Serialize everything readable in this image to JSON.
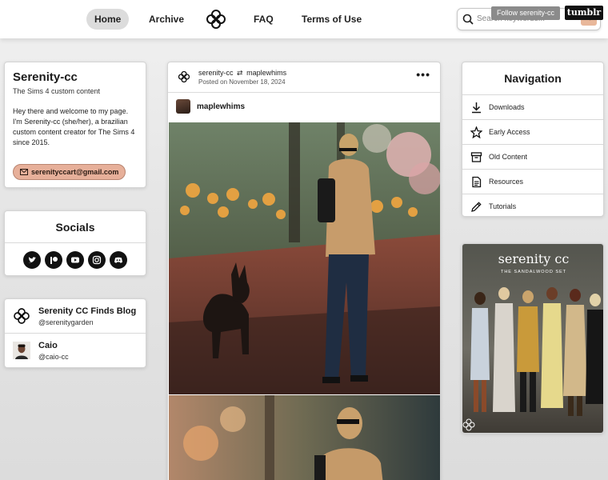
{
  "topnav": {
    "home": "Home",
    "archive": "Archive",
    "faq": "FAQ",
    "terms": "Terms of Use",
    "search_placeholder": "Search keywords...",
    "follow_label": "Follow serenity-cc",
    "tumblr_label": "tumblr"
  },
  "profile": {
    "name": "Serenity-cc",
    "tagline": "The Sims 4 custom content",
    "bio": "Hey there and welcome to my page. I'm Serenity-cc (she/her), a brazilian custom content creator for The Sims 4 since 2015.",
    "email": "serenityccart@gmail.com"
  },
  "socials": {
    "heading": "Socials",
    "icons": [
      "twitter-icon",
      "patreon-icon",
      "youtube-icon",
      "instagram-icon",
      "discord-icon"
    ]
  },
  "blogs": [
    {
      "title": "Serenity CC Finds Blog",
      "handle": "@serenitygarden"
    },
    {
      "title": "Caio",
      "handle": "@caio-cc"
    }
  ],
  "post": {
    "author": "serenity-cc",
    "reblog_from": "maplewhims",
    "date": "Posted on November 18, 2024",
    "more": "•••",
    "source_name": "maplewhims"
  },
  "navigation": {
    "heading": "Navigation",
    "items": [
      {
        "label": "Downloads",
        "icon": "download-icon"
      },
      {
        "label": "Early Access",
        "icon": "star-icon"
      },
      {
        "label": "Old Content",
        "icon": "archive-box-icon"
      },
      {
        "label": "Resources",
        "icon": "document-icon"
      },
      {
        "label": "Tutorials",
        "icon": "pencil-icon"
      }
    ]
  },
  "promo": {
    "title": "serenity cc",
    "subtitle": "THE SANDALWOOD SET"
  },
  "colors": {
    "accent": "#e7b09a",
    "dark": "#111111"
  }
}
